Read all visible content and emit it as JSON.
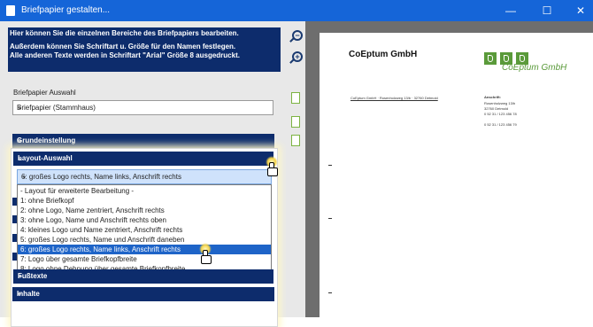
{
  "window": {
    "title": "Briefpapier gestalten...",
    "minimize": "—",
    "maximize": "☐",
    "close": "✕"
  },
  "info_text": [
    "Hier können Sie die einzelnen Bereiche des Briefpapiers bearbeiten.",
    "Außerdem können Sie Schriftart u. Größe für den Namen festlegen.",
    "Alle anderen Texte werden in Schriftart \"Arial\" Größe 8 ausgedruckt."
  ],
  "briefpapier": {
    "label": "Briefpapier Auswahl",
    "value": "Briefpapier (Stammhaus)"
  },
  "sections": {
    "grundeinstellung": "Grundeinstellung",
    "layout": "Layout-Auswahl",
    "fusstexte": "Fußtexte",
    "inhalte": "Inhalte"
  },
  "layout_selected": "6: großes Logo rechts, Name links, Anschrift rechts",
  "layout_options": [
    "- Layout für erweiterte Bearbeitung -",
    "1: ohne Briefkopf",
    "2: ohne Logo, Name zentriert, Anschrift rechts",
    "3: ohne Logo, Name und Anschrift rechts oben",
    "4: kleines Logo und Name zentriert, Anschrift rechts",
    "5: großes Logo rechts, Name und Anschrift daneben",
    "6: großes Logo rechts, Name links, Anschrift rechts",
    "7: Logo über gesamte Briefkopfbreite",
    "8: Logo ohne Dehnung über gesamte Briefkopfbreite"
  ],
  "preview": {
    "company_name": "CoEptum GmbH",
    "logo_text": "CoEptum GmbH",
    "sender_line": "CoEptum GmbH · Rosenholzweg 13/b · 32760 Detmold",
    "address_lines": [
      "Anschrift:",
      "Rosenholzweg 13/b",
      "32760 Detmold",
      "0 52 31 / 123 456 78",
      "",
      "0 52 31 / 123 456 79"
    ]
  },
  "icons": {
    "zoom_out": "zoom-out-icon",
    "zoom_in": "zoom-in-icon",
    "page": "page-icon",
    "chevron": "»",
    "arrow": "⌄"
  },
  "colors": {
    "titlebar": "#1565d8",
    "section": "#0d2c6c",
    "logo_green": "#5a9a3a",
    "selection": "#1e64c8"
  }
}
